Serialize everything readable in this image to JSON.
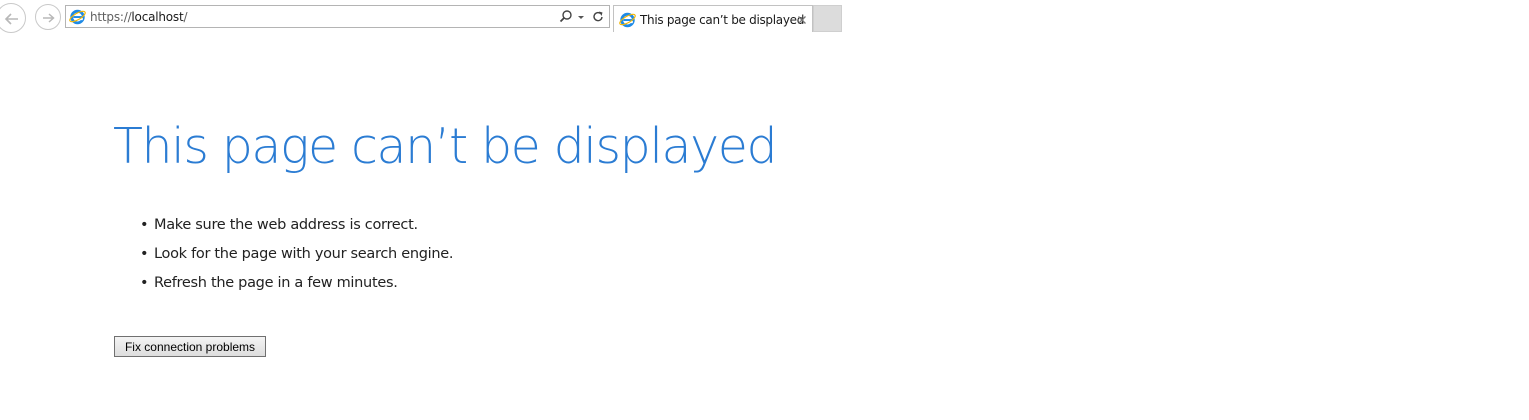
{
  "browser": {
    "url_scheme": "https://",
    "url_host": "localhost",
    "url_path": "/",
    "tab_title": "This page can’t be displayed",
    "icons": {
      "back": "back-arrow-icon",
      "forward": "forward-arrow-icon",
      "site": "ie-logo-icon",
      "search": "search-icon",
      "dropdown": "chevron-down-icon",
      "refresh": "refresh-icon",
      "close": "close-icon"
    }
  },
  "error_page": {
    "heading": "This page can’t be displayed",
    "bullet_symbol": "•",
    "suggestions": [
      "Make sure the web address is correct.",
      "Look for the page with your search engine.",
      "Refresh the page in a few minutes."
    ],
    "fix_button_label": "Fix connection problems"
  },
  "colors": {
    "heading": "#2b7cd3",
    "ie_logo": "#1e8ae6",
    "ie_logo_ring": "#f2b705"
  }
}
